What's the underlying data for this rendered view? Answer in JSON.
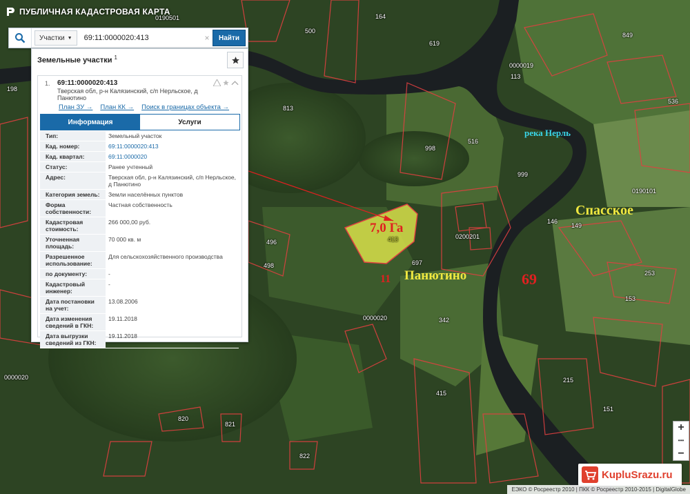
{
  "app": {
    "title": "ПУБЛИЧНАЯ КАДАСТРОВАЯ КАРТА"
  },
  "search": {
    "type": "Участки",
    "value": "69:11:0000020:413",
    "button": "Найти"
  },
  "panel": {
    "header": "Земельные участки",
    "count": "1",
    "item": {
      "number": "1.",
      "cad": "69:11:0000020:413",
      "address": "Тверская обл, р-н Калязинский, с/п Нерльское, д Панютино",
      "links": [
        "План ЗУ →",
        "План КК →",
        "Поиск в границах объекта →"
      ]
    },
    "tabs": [
      "Информация",
      "Услуги"
    ],
    "props": [
      {
        "k": "Тип:",
        "v": "Земельный участок"
      },
      {
        "k": "Кад. номер:",
        "v": "69:11:0000020:413",
        "link": true
      },
      {
        "k": "Кад. квартал:",
        "v": "69:11:0000020",
        "link": true
      },
      {
        "k": "Статус:",
        "v": "Ранее учтенный"
      },
      {
        "k": "Адрес:",
        "v": "Тверская обл, р-н Калязинский, с/п Нерльское, д Панютино"
      },
      {
        "k": "Категория земель:",
        "v": "Земли населённых пунктов"
      },
      {
        "k": "Форма собственности:",
        "v": "Частная собственность"
      },
      {
        "k": "Кадастровая стоимость:",
        "v": "266 000,00 руб."
      },
      {
        "k": "Уточненная площадь:",
        "v": "70 000 кв. м"
      },
      {
        "k": "Разрешенное использование:",
        "v": "Для сельскохозяйственного производства"
      },
      {
        "k": "по документу:",
        "v": "-"
      },
      {
        "k": "Кадастровый инженер:",
        "v": "-"
      },
      {
        "k": "Дата постановки на учет:",
        "v": "13.08.2006"
      },
      {
        "k": "Дата изменения сведений в ГКН:",
        "v": "19.11.2018"
      },
      {
        "k": "Дата выгрузки сведений из ГКН:",
        "v": "19.11.2018"
      }
    ]
  },
  "map": {
    "area_label": "7,0 Га",
    "plot_tag": "413",
    "river": "река Нерль",
    "village1": "Спасское",
    "village2": "Панютино",
    "num11": "11",
    "num69": "69",
    "labels": [
      "0190501",
      "164",
      "500",
      "619",
      "0000019",
      "113",
      "849",
      "198",
      "813",
      "998",
      "516",
      "999",
      "0190101",
      "536",
      "496",
      "498",
      "697",
      "0200201",
      "342",
      "0000020",
      "0000020",
      "415",
      "820",
      "821",
      "822",
      "215",
      "151",
      "253",
      "153",
      "146",
      "149"
    ]
  },
  "zoom": {
    "in": "+",
    "out": "−",
    "dots": "•••"
  },
  "attribution": "ЕЭКО © Росреестр 2010 | ПКК © Росреестр 2010-2015 | DigitalGlobe",
  "watermark": "KupluSrazu.ru",
  "colors": {
    "accent": "#1a6aa8",
    "parcel_border": "#e04040",
    "selected_fill": "#d8e04a"
  }
}
